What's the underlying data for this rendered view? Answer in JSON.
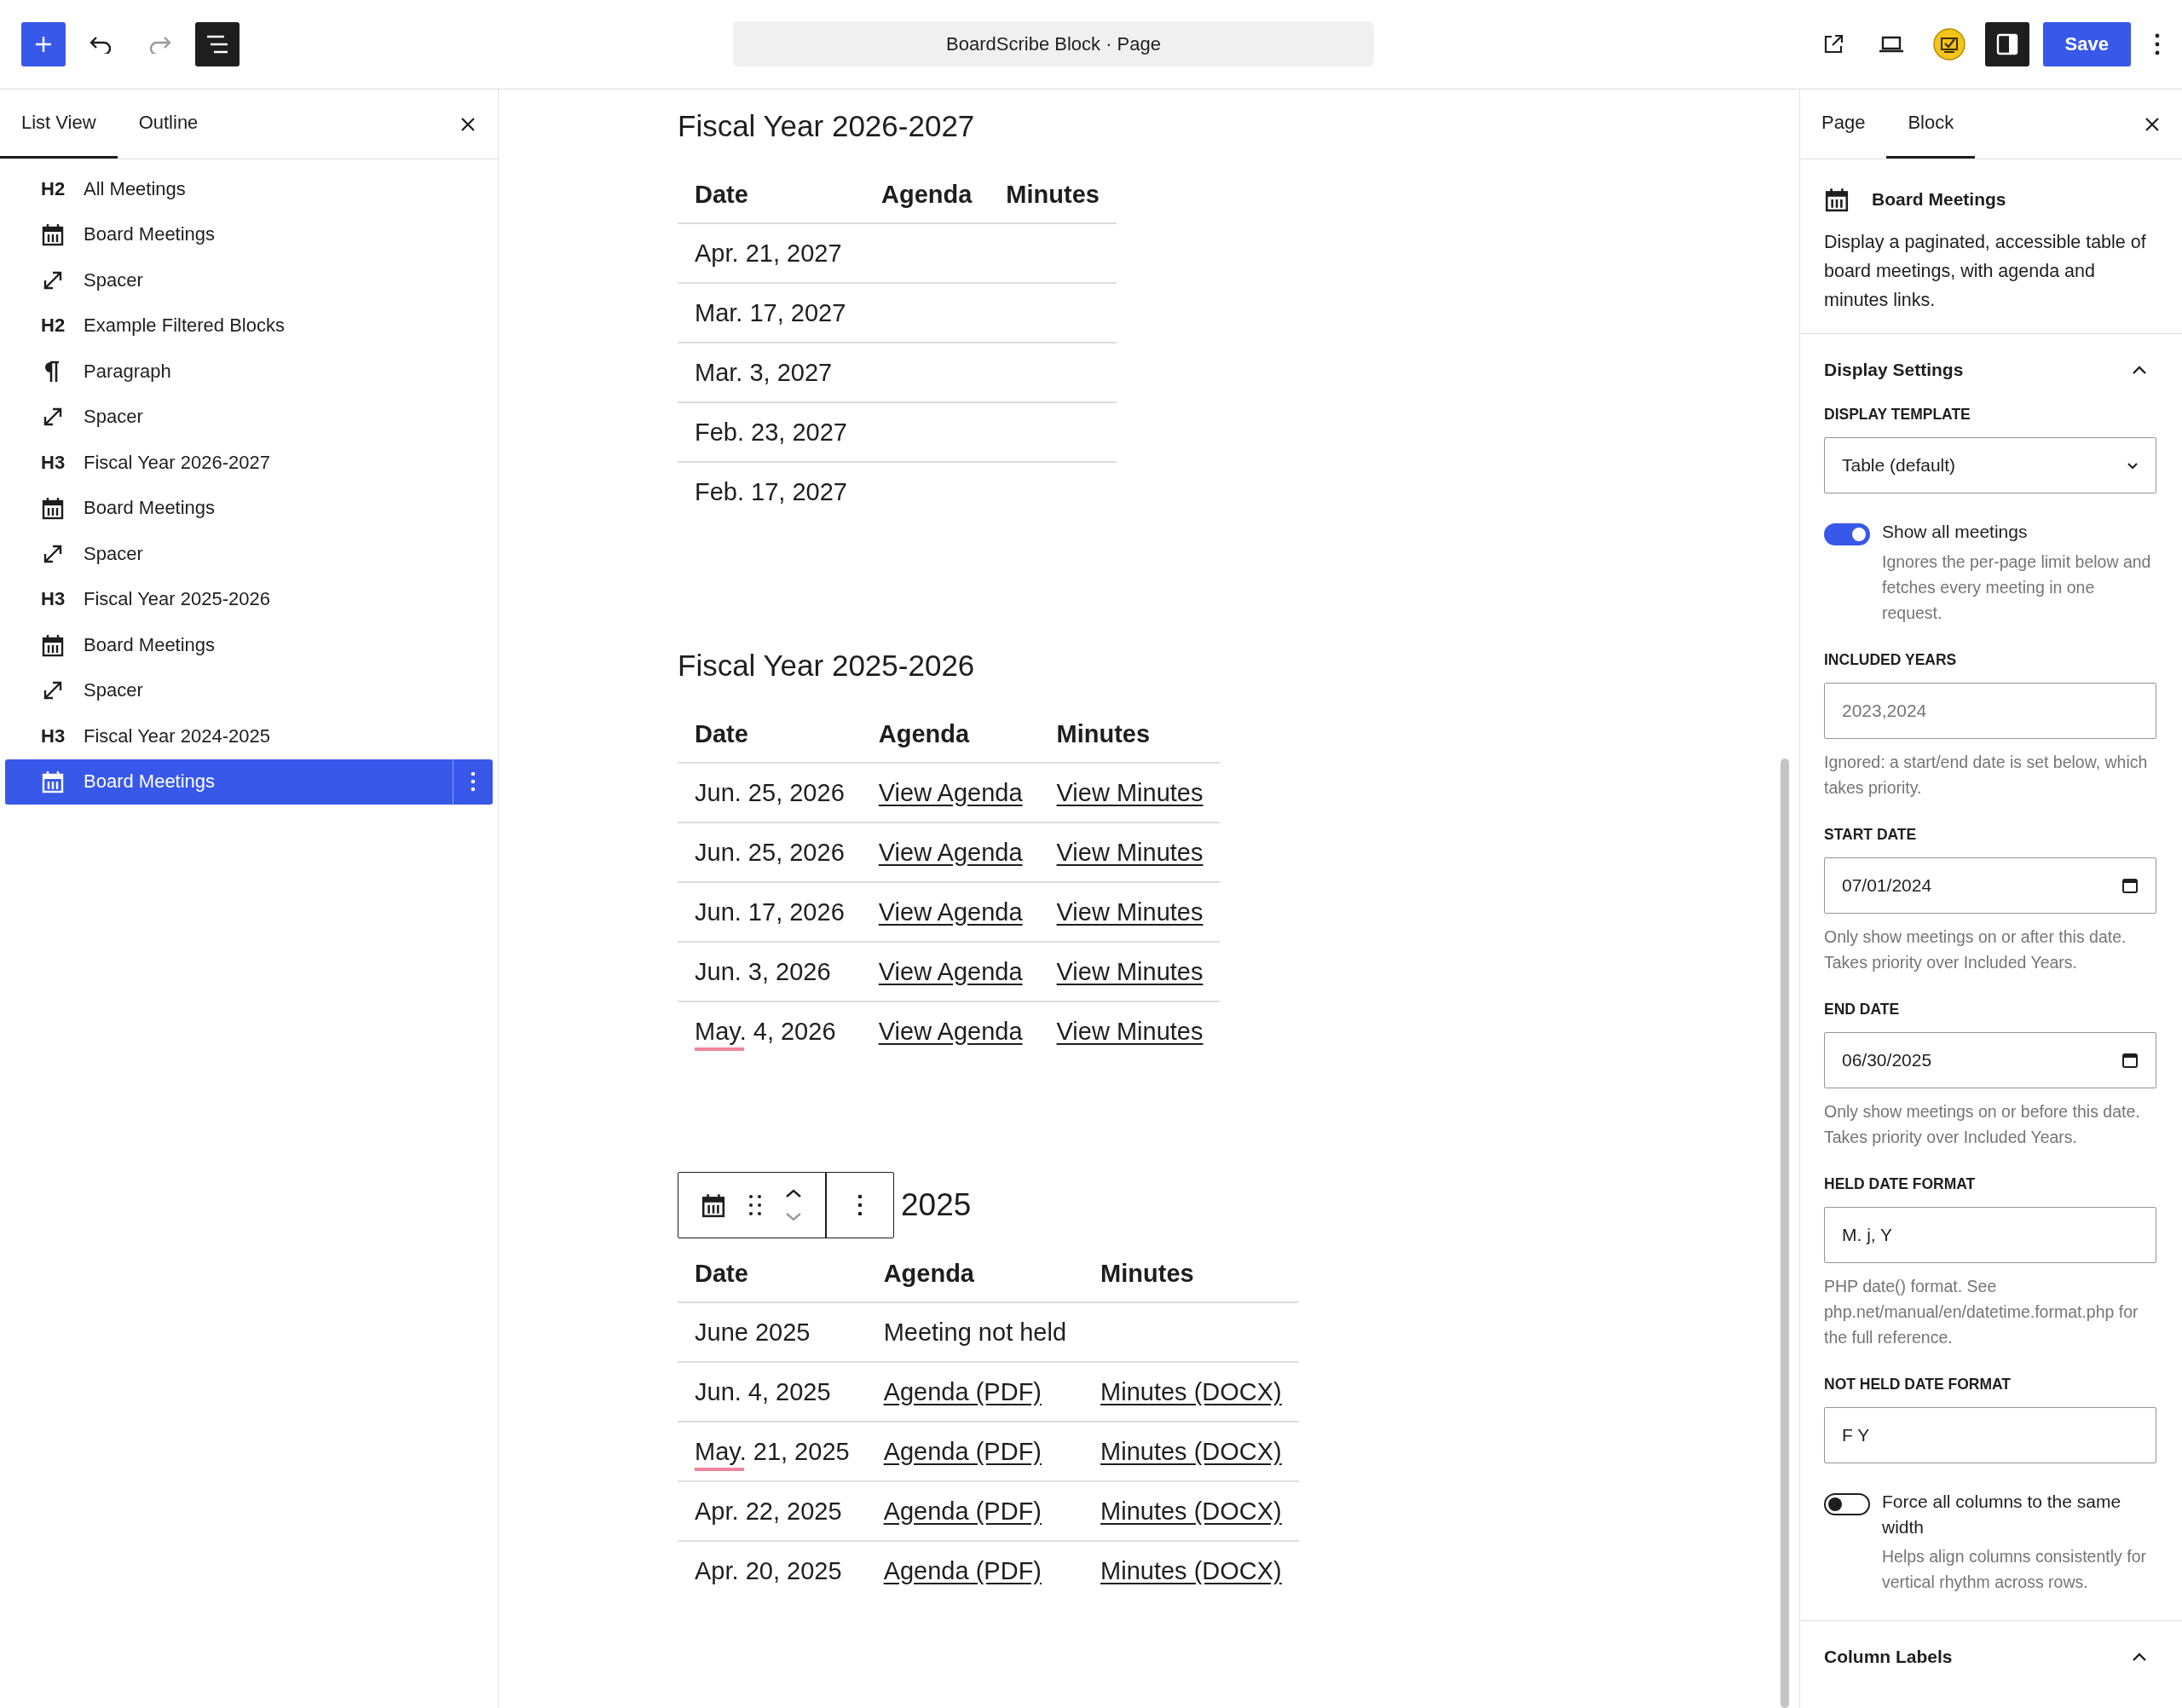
{
  "toolbar": {
    "title": "BoardScribe Block · Page",
    "redo_disabled": true,
    "list_view_pressed": true,
    "settings_pressed": true,
    "save": "Save"
  },
  "list_panel": {
    "tabs": [
      {
        "label": "List View",
        "selected": true
      },
      {
        "label": "Outline",
        "selected": false
      }
    ],
    "items": [
      {
        "kind": "heading",
        "badge": "H2",
        "label": "All Meetings",
        "selected": false
      },
      {
        "kind": "calendar",
        "label": "Board Meetings",
        "selected": false
      },
      {
        "kind": "spacer",
        "label": "Spacer",
        "selected": false
      },
      {
        "kind": "heading",
        "badge": "H2",
        "label": "Example Filtered Blocks",
        "selected": false
      },
      {
        "kind": "paragraph",
        "label": "Paragraph",
        "selected": false
      },
      {
        "kind": "spacer",
        "label": "Spacer",
        "selected": false
      },
      {
        "kind": "heading",
        "badge": "H3",
        "label": "Fiscal Year 2026-2027",
        "selected": false
      },
      {
        "kind": "calendar",
        "label": "Board Meetings",
        "selected": false
      },
      {
        "kind": "spacer",
        "label": "Spacer",
        "selected": false
      },
      {
        "kind": "heading",
        "badge": "H3",
        "label": "Fiscal Year 2025-2026",
        "selected": false
      },
      {
        "kind": "calendar",
        "label": "Board Meetings",
        "selected": false
      },
      {
        "kind": "spacer",
        "label": "Spacer",
        "selected": false
      },
      {
        "kind": "heading",
        "badge": "H3",
        "label": "Fiscal Year 2024-2025",
        "selected": false
      },
      {
        "kind": "calendar",
        "label": "Board Meetings",
        "selected": true
      }
    ]
  },
  "sections": [
    {
      "heading": "Fiscal Year 2026-2027",
      "block_toolbar": false,
      "columns": [
        "Date",
        "Agenda",
        "Minutes"
      ],
      "rows": [
        {
          "date": "Apr. 21, 2027",
          "spell_flag": false
        },
        {
          "date": "Mar. 17, 2027",
          "spell_flag": false
        },
        {
          "date": "Mar. 3, 2027",
          "spell_flag": false
        },
        {
          "date": "Feb. 23, 2027",
          "spell_flag": false
        },
        {
          "date": "Feb. 17, 2027",
          "spell_flag": false
        }
      ]
    },
    {
      "heading": "Fiscal Year 2025-2026",
      "block_toolbar": false,
      "columns": [
        "Date",
        "Agenda",
        "Minutes"
      ],
      "rows": [
        {
          "date": "Jun. 25, 2026",
          "spell_flag": false,
          "agenda": {
            "text": "View Agenda",
            "link": true
          },
          "minutes": {
            "text": "View Minutes",
            "link": true
          }
        },
        {
          "date": "Jun. 25, 2026",
          "spell_flag": false,
          "agenda": {
            "text": "View Agenda",
            "link": true
          },
          "minutes": {
            "text": "View Minutes",
            "link": true
          }
        },
        {
          "date": "Jun. 17, 2026",
          "spell_flag": false,
          "agenda": {
            "text": "View Agenda",
            "link": true
          },
          "minutes": {
            "text": "View Minutes",
            "link": true
          }
        },
        {
          "date": "Jun. 3, 2026",
          "spell_flag": false,
          "agenda": {
            "text": "View Agenda",
            "link": true
          },
          "minutes": {
            "text": "View Minutes",
            "link": true
          }
        },
        {
          "date": "May. 4, 2026",
          "spell_flag": true,
          "agenda": {
            "text": "View Agenda",
            "link": true
          },
          "minutes": {
            "text": "View Minutes",
            "link": true
          }
        }
      ]
    },
    {
      "heading": "2025",
      "block_toolbar": true,
      "columns": [
        "Date",
        "Agenda",
        "Minutes"
      ],
      "rows": [
        {
          "date": "June 2025",
          "spell_flag": false,
          "agenda": {
            "text": "Meeting not held",
            "link": false
          }
        },
        {
          "date": "Jun. 4, 2025",
          "spell_flag": false,
          "agenda": {
            "text": "Agenda (PDF)",
            "link": true
          },
          "minutes": {
            "text": "Minutes (DOCX)",
            "link": true
          }
        },
        {
          "date": "May. 21, 2025",
          "spell_flag": true,
          "agenda": {
            "text": "Agenda (PDF)",
            "link": true
          },
          "minutes": {
            "text": "Minutes (DOCX)",
            "link": true
          }
        },
        {
          "date": "Apr. 22, 2025",
          "spell_flag": false,
          "agenda": {
            "text": "Agenda (PDF)",
            "link": true
          },
          "minutes": {
            "text": "Minutes (DOCX)",
            "link": true
          }
        },
        {
          "date": "Apr. 20, 2025",
          "spell_flag": false,
          "agenda": {
            "text": "Agenda (PDF)",
            "link": true
          },
          "minutes": {
            "text": "Minutes (DOCX)",
            "link": true
          }
        }
      ]
    }
  ],
  "settings_panel": {
    "tabs": [
      {
        "label": "Page",
        "selected": false
      },
      {
        "label": "Block",
        "selected": true
      }
    ],
    "block": {
      "title": "Board Meetings",
      "description": "Display a paginated, accessible table of board meetings, with agenda and minutes links."
    },
    "section_title": "Display Settings",
    "expanded": true,
    "controls": [
      {
        "kind": "select",
        "label": "DISPLAY TEMPLATE",
        "value": "Table (default)"
      },
      {
        "kind": "toggle",
        "label": "Show all meetings",
        "on": true,
        "help": "Ignores the per-page limit below and fetches every meeting in one request."
      },
      {
        "kind": "text",
        "label": "INCLUDED YEARS",
        "placeholder": "2023,2024",
        "help": "Ignored: a start/end date is set below, which takes priority."
      },
      {
        "kind": "date",
        "label": "START DATE",
        "value": "07/01/2024",
        "help": "Only show meetings on or after this date. Takes priority over Included Years."
      },
      {
        "kind": "date",
        "label": "END DATE",
        "value": "06/30/2025",
        "help": "Only show meetings on or before this date. Takes priority over Included Years."
      },
      {
        "kind": "text",
        "label": "HELD DATE FORMAT",
        "value": "M. j, Y",
        "help": "PHP date() format. See php.net/manual/en/datetime.format.php for the full reference."
      },
      {
        "kind": "text",
        "label": "NOT HELD DATE FORMAT",
        "value": "F Y"
      },
      {
        "kind": "toggle",
        "label": "Force all columns to the same width",
        "on": false,
        "help": "Helps align columns consistently for vertical rhythm across rows."
      }
    ],
    "next_section": {
      "title": "Column Labels",
      "expanded": true
    }
  }
}
